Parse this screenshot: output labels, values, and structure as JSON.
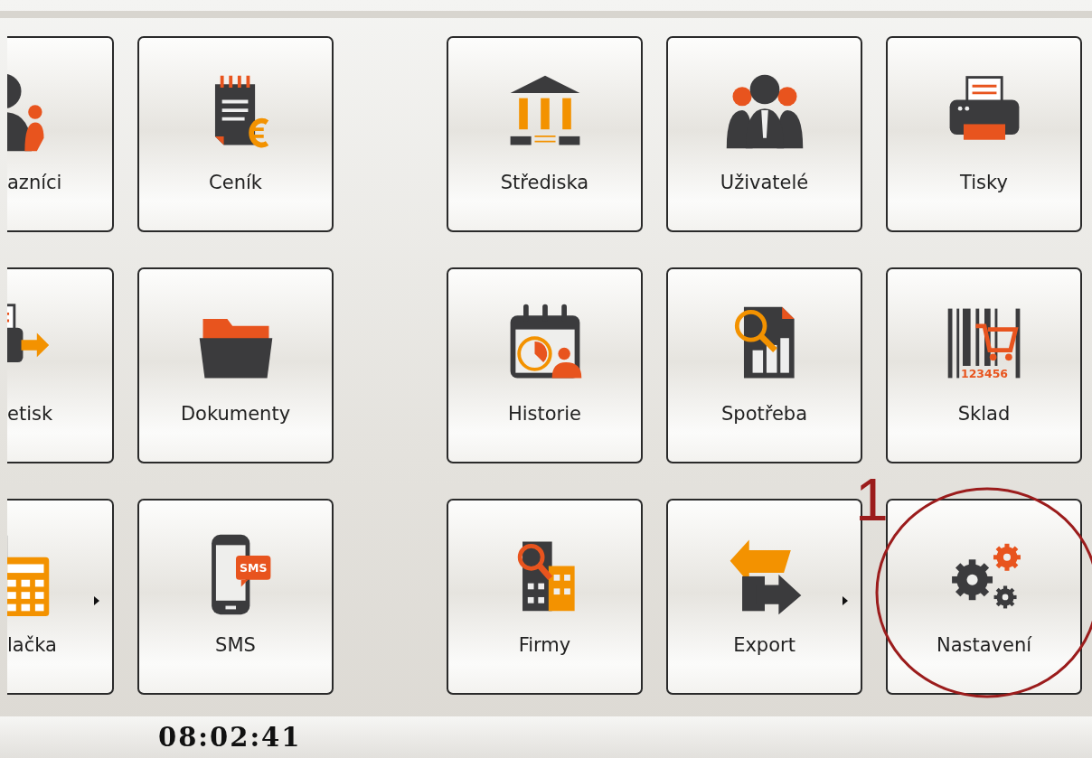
{
  "tiles": [
    {
      "label": "azníci",
      "has_submenu": false
    },
    {
      "label": "Ceník",
      "has_submenu": false
    },
    {
      "label": "Střediska",
      "has_submenu": false
    },
    {
      "label": "Uživatelé",
      "has_submenu": false
    },
    {
      "label": "Tisky",
      "has_submenu": false
    },
    {
      "label": "etisk",
      "has_submenu": false
    },
    {
      "label": "Dokumenty",
      "has_submenu": false
    },
    {
      "label": "Historie",
      "has_submenu": false
    },
    {
      "label": "Spotřeba",
      "has_submenu": false
    },
    {
      "label": "Sklad",
      "has_submenu": false,
      "icon_text": "123456"
    },
    {
      "label": "lačka",
      "has_submenu": true
    },
    {
      "label": "SMS",
      "has_submenu": false,
      "icon_text": "SMS"
    },
    {
      "label": "Firmy",
      "has_submenu": false
    },
    {
      "label": "Export",
      "has_submenu": true
    },
    {
      "label": "Nastavení",
      "has_submenu": false
    }
  ],
  "annotation": {
    "label": "1"
  },
  "status_bar": {
    "time": "08:02:41"
  }
}
